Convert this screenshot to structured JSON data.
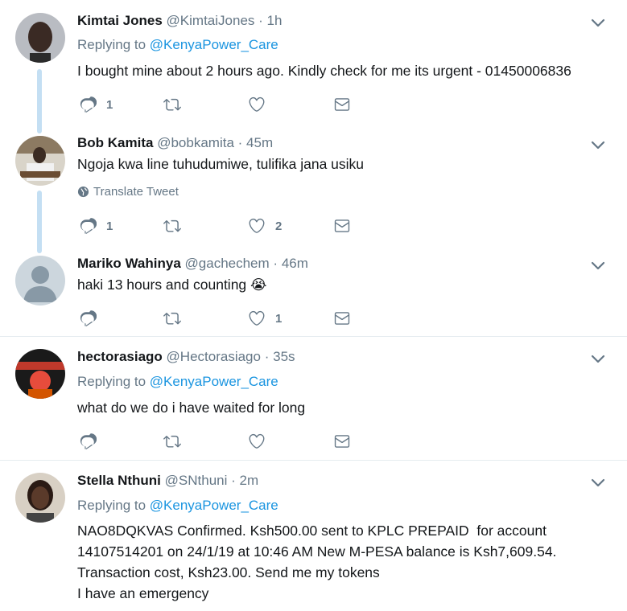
{
  "tweets": [
    {
      "name": "Kimtai Jones",
      "handle": "@KimtaiJones",
      "time": "1h",
      "reply_prefix": "Replying to",
      "reply_to": "@KenyaPower_Care",
      "text": "I bought mine about 2 hours ago. Kindly check for me its urgent - 01450006836",
      "replies": "1",
      "retweets": "",
      "likes": ""
    },
    {
      "name": "Bob Kamita",
      "handle": "@bobkamita",
      "time": "45m",
      "text": "Ngoja kwa line tuhudumiwe, tulifika jana usiku",
      "translate": "Translate Tweet",
      "replies": "1",
      "retweets": "",
      "likes": "2"
    },
    {
      "name": "Mariko Wahinya",
      "handle": "@gachechem",
      "time": "46m",
      "text": "haki 13 hours and counting 😭",
      "replies": "",
      "retweets": "",
      "likes": "1"
    },
    {
      "name": "hectorasiago",
      "handle": "@Hectorasiago",
      "time": "35s",
      "reply_prefix": "Replying to",
      "reply_to": "@KenyaPower_Care",
      "text": "what do we do i have waited for long",
      "replies": "",
      "retweets": "",
      "likes": ""
    },
    {
      "name": "Stella Nthuni",
      "handle": "@SNthuni",
      "time": "2m",
      "reply_prefix": "Replying to",
      "reply_to": "@KenyaPower_Care",
      "text_lines": [
        "NAO8DQKVAS Confirmed. Ksh500.00 sent to KPLC PREPAID  for account",
        "14107514201 on 24/1/19 at 10:46 AM New M-PESA balance is Ksh7,609.54.",
        "Transaction cost, Ksh23.00. Send me my tokens",
        "I have an emergency"
      ]
    }
  ],
  "dot": "·",
  "colors": {
    "accent": "#1b95e0",
    "muted": "#657786",
    "thread": "#c4dff3"
  }
}
